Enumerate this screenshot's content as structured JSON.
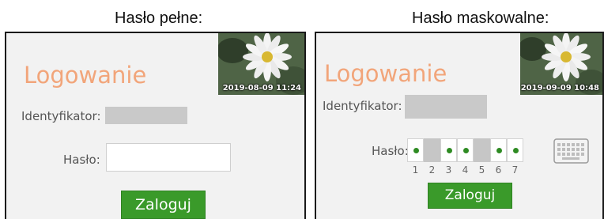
{
  "left": {
    "caption": "Hasło pełne:",
    "title": "Logowanie",
    "timestamp": "2019-08-09 11:24",
    "id_label": "Identyfikator:",
    "password_label": "Hasło:",
    "login_button": "Zaloguj"
  },
  "right": {
    "caption": "Hasło maskowalne:",
    "title": "Logowanie",
    "timestamp": "2019-09-09 10:48",
    "id_label": "Identyfikator:",
    "password_label": "Hasło:",
    "login_button": "Zaloguj",
    "mask_positions": [
      {
        "label": "1",
        "active": true
      },
      {
        "label": "2",
        "active": false
      },
      {
        "label": "3",
        "active": true
      },
      {
        "label": "4",
        "active": true
      },
      {
        "label": "5",
        "active": false
      },
      {
        "label": "6",
        "active": true
      },
      {
        "label": "7",
        "active": true
      }
    ]
  },
  "colors": {
    "title": "#f2a57a",
    "button": "#3a9a2a",
    "dot": "#2e8b23",
    "inactive_cell": "#c6c6c6"
  }
}
